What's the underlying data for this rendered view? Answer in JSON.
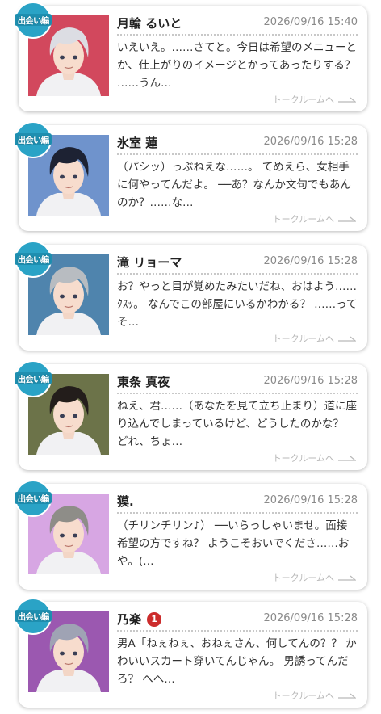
{
  "badge_label": "出会い編",
  "talk_link_label": "トークルームへ",
  "threads": [
    {
      "name": "月輪 るいと",
      "time": "2026/09/16 15:40",
      "message": "いえいえ。……さてと。今日は希望のメニューとか、仕上がりのイメージとかってあったりする？ ……うん…",
      "unread": "",
      "avatar_bg": "#d2485d",
      "hair": "#dcdde3"
    },
    {
      "name": "氷室 蓮",
      "time": "2026/09/16 15:28",
      "message": "（パシッ）っぶねえな……。 てめえら、女相手に何やってんだよ。 ──あ？なんか文句でもあんのか？……な…",
      "unread": "",
      "avatar_bg": "#6f93cc",
      "hair": "#1d2233"
    },
    {
      "name": "滝 リョーマ",
      "time": "2026/09/16 15:28",
      "message": "お？やっと目が覚めたみたいだね、おはよう……ｸｽｯ。 なんでこの部屋にいるかわかる？ ……ってそ…",
      "unread": "",
      "avatar_bg": "#4f84ad",
      "hair": "#b8bcc1"
    },
    {
      "name": "東条 真夜",
      "time": "2026/09/16 15:28",
      "message": "ねえ、君……（あなたを見て立ち止まり）道に座り込んでしまっているけど、どうしたのかな？ どれ、ちょ…",
      "unread": "",
      "avatar_bg": "#6c7349",
      "hair": "#231d1b"
    },
    {
      "name": "獏.",
      "time": "2026/09/16 15:28",
      "message": "（チリンチリン♪） ──いらっしゃいませ。面接希望の方ですね？ ようこそおいでくださ……おや。(…",
      "unread": "",
      "avatar_bg": "#d7a6e3",
      "hair": "#8e8d88"
    },
    {
      "name": "乃楽",
      "time": "2026/09/16 15:28",
      "message": "男A「ねぇねぇ、おねぇさん、何してんの？？ かわいいスカート穿いてんじゃん。 男誘ってんだろ？ へへ…",
      "unread": "1",
      "avatar_bg": "#9b58b0",
      "hair": "#9fa3b4"
    }
  ]
}
